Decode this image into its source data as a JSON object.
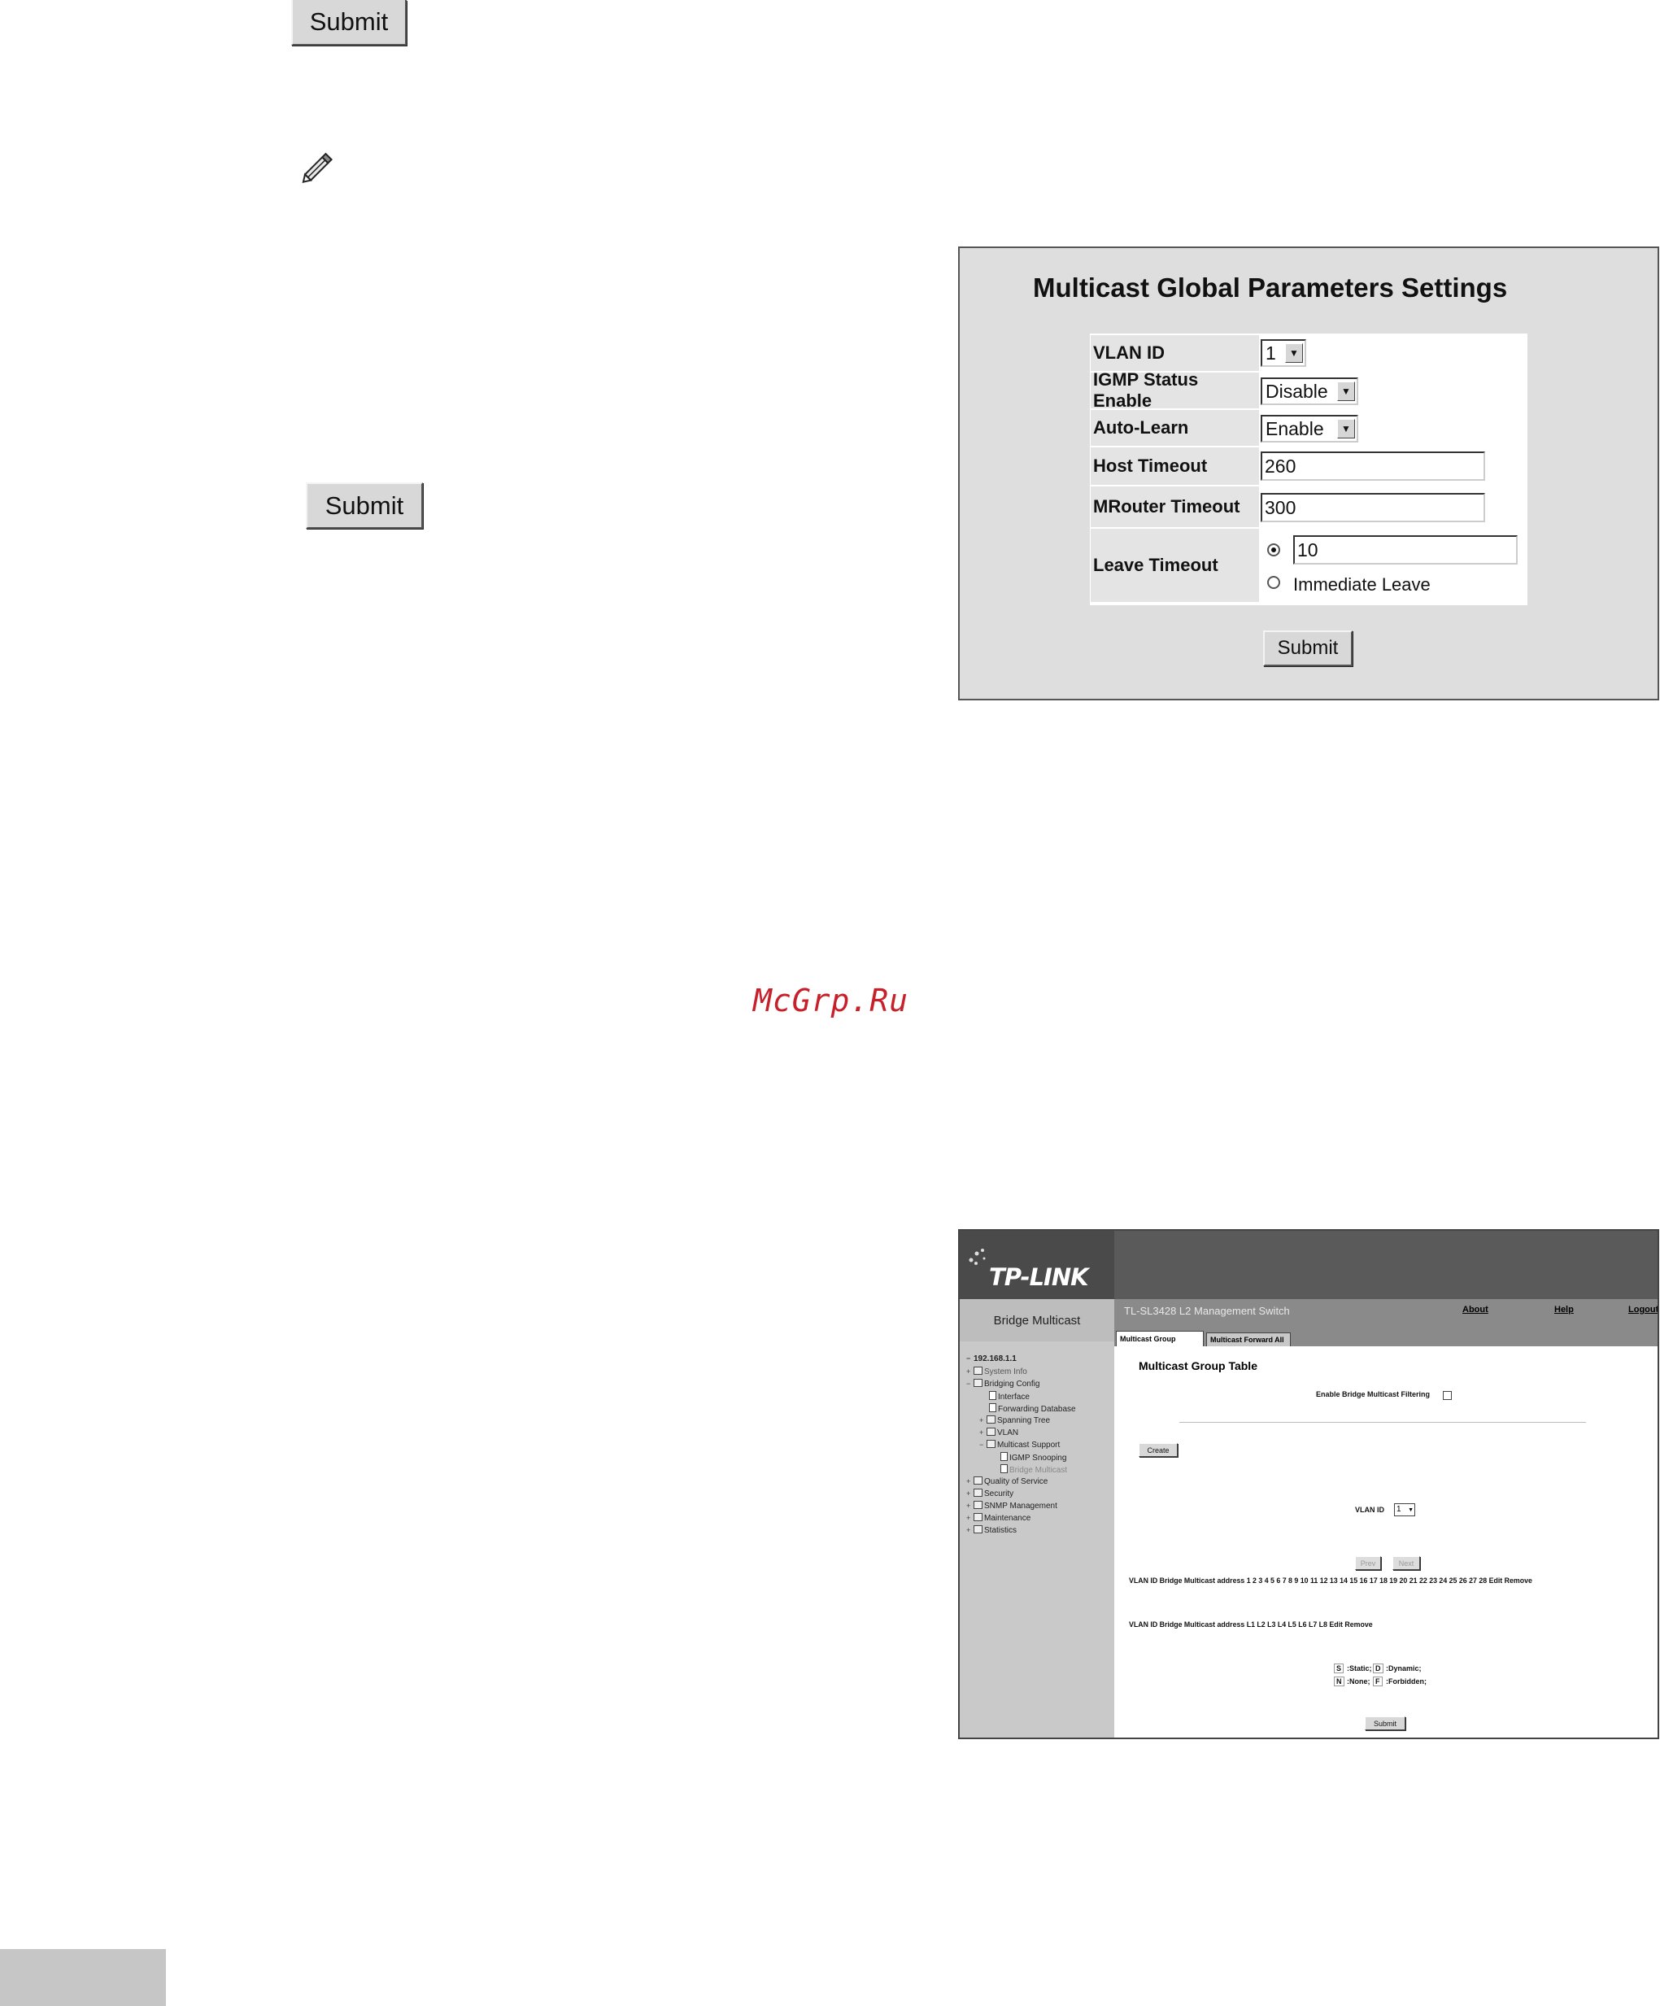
{
  "top_button": {
    "label": "Submit"
  },
  "middle_button": {
    "label": "Submit"
  },
  "watermark": "McGrp.Ru",
  "multicast_global": {
    "title": "Multicast Global Parameters Settings",
    "fields": {
      "vlan_id": {
        "label": "VLAN ID",
        "value": "1"
      },
      "igmp_status": {
        "label": "IGMP Status Enable",
        "value": "Disable"
      },
      "auto_learn": {
        "label": "Auto-Learn",
        "value": "Enable"
      },
      "host_timeout": {
        "label": "Host Timeout",
        "value": "260"
      },
      "mrouter_timeout": {
        "label": "MRouter Timeout",
        "value": "300"
      },
      "leave_timeout": {
        "label": "Leave Timeout",
        "value": "10",
        "option2": "Immediate Leave"
      }
    },
    "submit_label": "Submit"
  },
  "tplink": {
    "logo": "TP-LINK",
    "device": "TL-SL3428 L2 Management Switch",
    "links": {
      "about": "About",
      "help": "Help",
      "logout": "Logout"
    },
    "sidebar_title": "Bridge Multicast",
    "tabs": {
      "group": "Multicast Group",
      "forward_all": "Multicast Forward All"
    },
    "tree": {
      "root": "192.168.1.1",
      "system_info": "System Info",
      "bridging_config": "Bridging Config",
      "interface": "Interface",
      "forwarding_database": "Forwarding Database",
      "spanning_tree": "Spanning Tree",
      "vlan": "VLAN",
      "multicast_support": "Multicast Support",
      "igmp_snooping": "IGMP Snooping",
      "bridge_multicast": "Bridge Multicast",
      "qos": "Quality of Service",
      "security": "Security",
      "snmp": "SNMP Management",
      "maintenance": "Maintenance",
      "statistics": "Statistics"
    },
    "content": {
      "title": "Multicast Group Table",
      "enable_filtering": "Enable Bridge Multicast Filtering",
      "create": "Create",
      "vlan_id_label": "VLAN ID",
      "vlan_id_value": "1",
      "prev": "Prev",
      "next": "Next",
      "header_ports": "VLAN ID Bridge Multicast address 1 2 3 4 5 6 7 8 9 10 11 12 13 14 15 16 17 18 19 20 21 22 23 24 25 26 27 28 Edit Remove",
      "header_lags": "VLAN ID Bridge Multicast address L1 L2 L3 L4 L5 L6 L7 L8 Edit Remove",
      "legend": {
        "s": "S",
        "static": ":Static;",
        "d": "D",
        "dynamic": ":Dynamic;",
        "n": "N",
        "none": ":None;",
        "f": "F",
        "forbidden": ":Forbidden;"
      },
      "submit": "Submit"
    }
  }
}
